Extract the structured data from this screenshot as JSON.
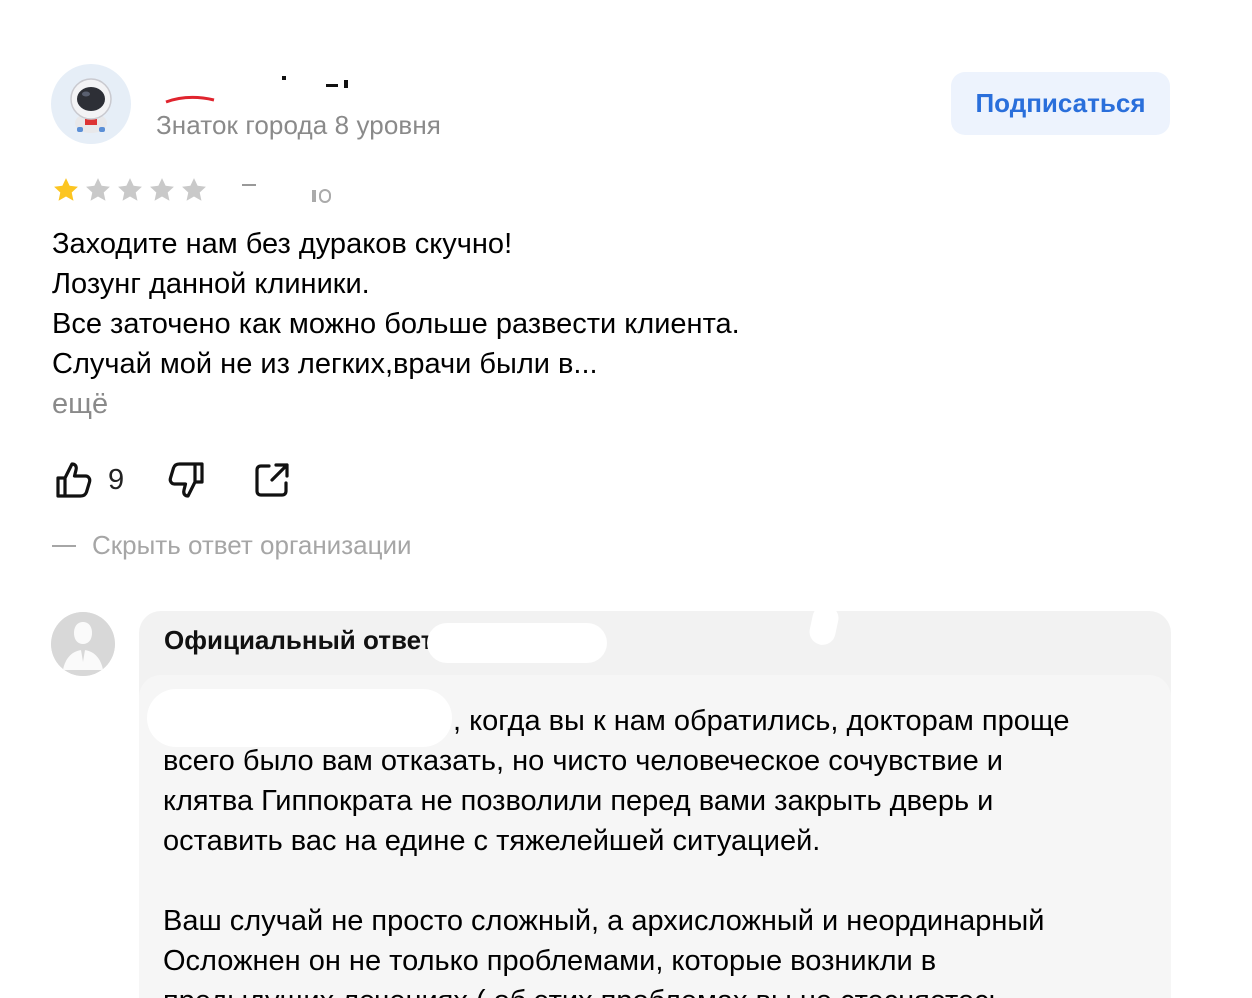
{
  "author": {
    "level": "Знаток города 8 уровня"
  },
  "subscribe_button": "Подписаться",
  "rating": {
    "stars_filled": 1,
    "stars_total": 5,
    "filled_color": "#fcc521",
    "empty_color": "#c9c9c9"
  },
  "review": {
    "lines": [
      "Заходите нам без дураков скучно!",
      "Лозунг данной клиники.",
      "Все заточено как можно больше развести клиента.",
      "Случай мой не из легких,врачи были в..."
    ],
    "more": "ещё"
  },
  "actions": {
    "like_count": "9"
  },
  "hide_answer": "Скрыть ответ организации",
  "answer": {
    "header": "Официальный ответ",
    "paragraph1": [
      ", когда вы к нам обратились, докторам проще",
      "всего было вам отказать, но чисто человеческое сочувствие и",
      "клятва Гиппократа не позволили  перед вами закрыть дверь и",
      "оставить вас на едине с тяжелейшей ситуацией."
    ],
    "paragraph2": [
      "Ваш случай не просто сложный, а архисложный и неординарный",
      "Осложнен он не только проблемами, которые возникли в",
      "предыдущих лечениях ( об этих проблемах вы не стесняетесь"
    ]
  },
  "colors": {
    "accent": "#2a6fdb",
    "muted_text": "#8a8a8a",
    "card_bg": "#f2f2f2"
  }
}
